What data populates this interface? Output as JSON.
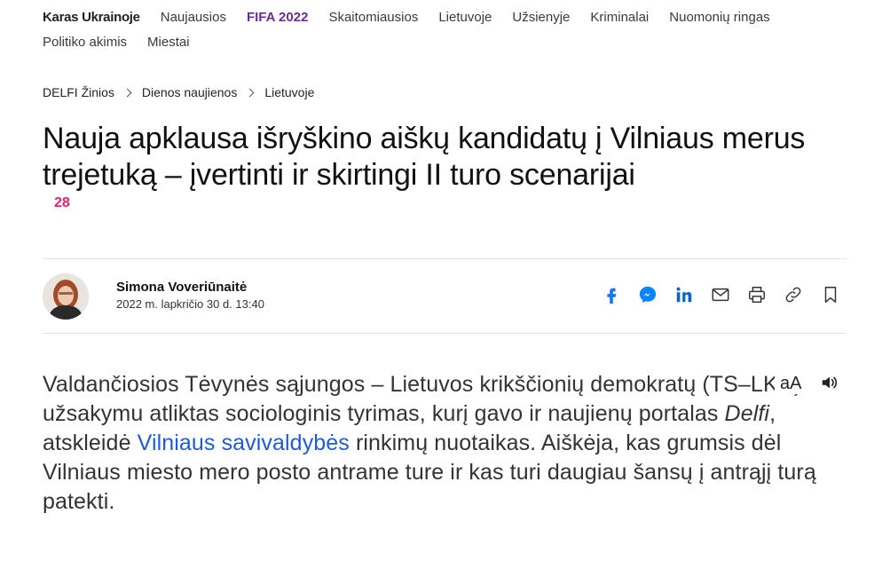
{
  "nav": {
    "items": [
      {
        "label": "Karas Ukrainoje"
      },
      {
        "label": "Naujausios"
      },
      {
        "label": "FIFA 2022"
      },
      {
        "label": "Skaitomiausios"
      },
      {
        "label": "Lietuvoje"
      },
      {
        "label": "Užsienyje"
      },
      {
        "label": "Kriminalai"
      },
      {
        "label": "Nuomonių ringas"
      },
      {
        "label": "Politiko akimis"
      },
      {
        "label": "Miestai"
      }
    ]
  },
  "breadcrumb": [
    "DELFI Žinios",
    "Dienos naujienos",
    "Lietuvoje"
  ],
  "article": {
    "title": "Nauja apklausa išryškino aiškų kandidatų į Vilniaus merus trejetuką – įvertinti ir skirtingi II turo scenarijai",
    "comments_count": "28",
    "author": "Simona Voveriūnaitė",
    "date": "2022 m. lapkričio 30 d. 13:40",
    "lead": {
      "part1": "Valdančiosios Tėvynės sąjungos – Lietuvos krikščionių demokratų (TS–LKD) užsakymu atliktas sociologinis tyrimas, kurį gavo ir naujienų portalas ",
      "italic": "Delfi",
      "part2": ", atskleidė ",
      "link": "Vilniaus savivaldybės",
      "part3": " rinkimų nuotaikas. Aiškėja, kas grumsis dėl Vilniaus miesto mero posto antrame ture ir kas turi daugiau šansų į antrąjį turą patekti."
    }
  },
  "tools": {
    "font_size_label": "aA"
  },
  "share_icons": [
    "facebook-icon",
    "messenger-icon",
    "linkedin-icon",
    "email-icon",
    "print-icon",
    "link-icon",
    "bookmark-icon"
  ],
  "colors": {
    "fifa": "#6b2c91",
    "comments": "#e2206e",
    "link": "#1e5adf",
    "facebook": "#1877f2",
    "messenger": "#0a84ff",
    "linkedin": "#0a66c2"
  }
}
